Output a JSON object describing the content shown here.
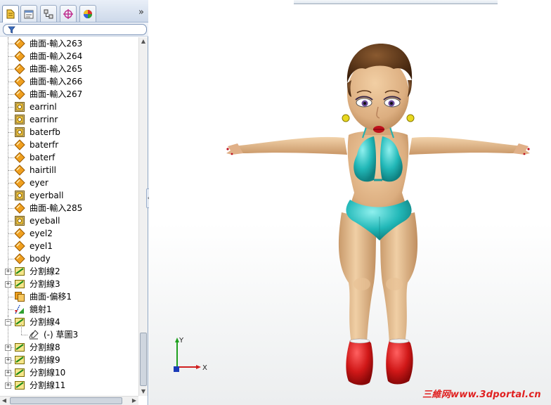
{
  "feature_tree": {
    "items": [
      {
        "label": "曲面-輸入263",
        "icon": "imported-surface-icon"
      },
      {
        "label": "曲面-輸入264",
        "icon": "imported-surface-icon"
      },
      {
        "label": "曲面-輸入265",
        "icon": "imported-surface-icon"
      },
      {
        "label": "曲面-輸入266",
        "icon": "imported-surface-icon"
      },
      {
        "label": "曲面-輸入267",
        "icon": "imported-surface-icon"
      },
      {
        "label": "earrinl",
        "icon": "solid-body-icon"
      },
      {
        "label": "earrinr",
        "icon": "solid-body-icon"
      },
      {
        "label": "baterfb",
        "icon": "solid-body-icon"
      },
      {
        "label": "baterfr",
        "icon": "imported-surface-icon"
      },
      {
        "label": "baterf",
        "icon": "imported-surface-icon"
      },
      {
        "label": "hairtill",
        "icon": "imported-surface-icon"
      },
      {
        "label": "eyer",
        "icon": "imported-surface-icon"
      },
      {
        "label": "eyerball",
        "icon": "solid-body-icon"
      },
      {
        "label": "曲面-輸入285",
        "icon": "imported-surface-icon"
      },
      {
        "label": "eyeball",
        "icon": "solid-body-icon"
      },
      {
        "label": "eyel2",
        "icon": "imported-surface-icon"
      },
      {
        "label": "eyel1",
        "icon": "imported-surface-icon"
      },
      {
        "label": "body",
        "icon": "imported-surface-icon"
      },
      {
        "label": "分割線2",
        "icon": "split-line-icon"
      },
      {
        "label": "分割線3",
        "icon": "split-line-icon"
      },
      {
        "label": "曲面-偏移1",
        "icon": "offset-surface-icon"
      },
      {
        "label": "鏡射1",
        "icon": "mirror-icon"
      },
      {
        "label": "分割線4",
        "icon": "split-line-icon"
      },
      {
        "label": "(-) 草圖3",
        "icon": "sketch-icon"
      },
      {
        "label": "分割線8",
        "icon": "split-line-icon"
      },
      {
        "label": "分割線9",
        "icon": "split-line-icon"
      },
      {
        "label": "分割線10",
        "icon": "split-line-icon"
      },
      {
        "label": "分割線11",
        "icon": "split-line-icon"
      }
    ],
    "expanded_item": "分割線4"
  },
  "panel_tabs": [
    "feature-manager-tab-icon",
    "property-manager-tab-icon",
    "configuration-manager-tab-icon",
    "dimxpert-manager-tab-icon",
    "display-manager-tab-icon"
  ],
  "triad": {
    "x_label": "X",
    "y_label": "Y"
  },
  "watermark": "三維网www.3dportal.cn",
  "colors": {
    "surface_icon": "#f0a020",
    "skin": "#e4b98c",
    "bikini": "#2ec0c0",
    "hair": "#5a3418",
    "boots": "#d01818",
    "watermark": "#e02020"
  }
}
